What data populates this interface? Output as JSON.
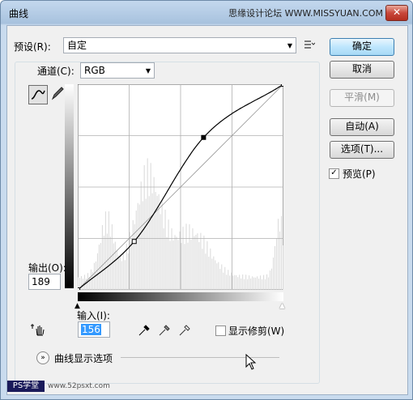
{
  "window": {
    "title": "曲线",
    "watermark": "思缘设计论坛  WWW.MISSYUAN.COM",
    "close_icon": "close-icon"
  },
  "preset": {
    "label": "预设(R):",
    "value": "自定"
  },
  "channel": {
    "label": "通道(C):",
    "value": "RGB"
  },
  "output": {
    "label": "输出(O):",
    "value": "189"
  },
  "input": {
    "label": "输入(I):",
    "value": "156"
  },
  "buttons": {
    "ok": "确定",
    "cancel": "取消",
    "smooth": "平滑(M)",
    "auto": "自动(A)",
    "options": "选项(T)..."
  },
  "preview": {
    "label": "预览(P)",
    "checked": true
  },
  "show_clipping": {
    "label": "显示修剪(W)",
    "checked": false
  },
  "curve_options": {
    "label": "曲线显示选项"
  },
  "logo": {
    "text": "PS学堂",
    "url": "www.52psxt.com"
  },
  "chart_data": {
    "type": "line",
    "xlim": [
      0,
      255
    ],
    "ylim": [
      0,
      255
    ],
    "grid": true,
    "curve_points": [
      [
        0,
        0
      ],
      [
        70,
        60
      ],
      [
        156,
        189
      ],
      [
        255,
        255
      ]
    ],
    "identity_line": true
  }
}
